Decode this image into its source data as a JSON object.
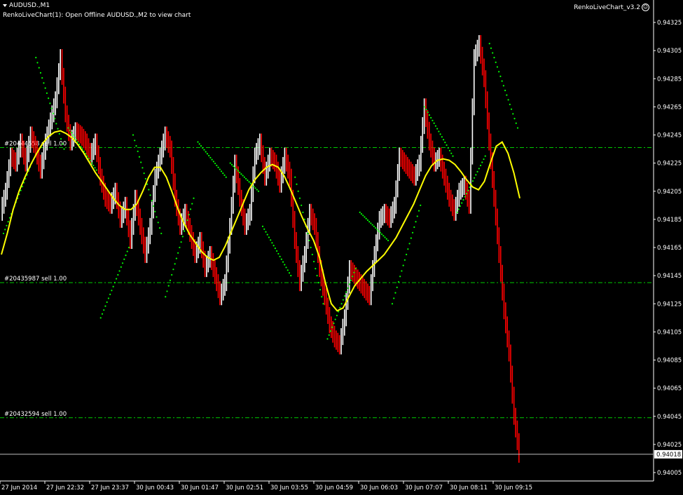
{
  "header": {
    "symbol_label": "AUDUSD.,M1",
    "status_text": "RenkoLiveChart(1): Open Offline AUDUSD.,M2 to view chart",
    "indicator_label": "RenkoLiveChart_v3.2"
  },
  "colors": {
    "background": "#000000",
    "bull_candle": "#ffffff",
    "bear_candle": "#ff0000",
    "moving_average": "#ffff00",
    "sar_dots": "#00ff00",
    "order_lines": "#00cc00",
    "axis_text": "#ffffff"
  },
  "chart_data": {
    "type": "line",
    "title": "",
    "xlabel": "",
    "ylabel": "",
    "ylim": [
      0.93995,
      0.94335
    ],
    "grid": false,
    "x_ticks": [
      "27 Jun 2014",
      "27 Jun 22:32",
      "27 Jun 23:37",
      "30 Jun 00:43",
      "30 Jun 01:47",
      "30 Jun 02:51",
      "30 Jun 03:55",
      "30 Jun 04:59",
      "30 Jun 06:03",
      "30 Jun 07:07",
      "30 Jun 08:11",
      "30 Jun 09:15"
    ],
    "y_ticks": [
      "0.94325",
      "0.94305",
      "0.94285",
      "0.94265",
      "0.94245",
      "0.94225",
      "0.94205",
      "0.94185",
      "0.94165",
      "0.94145",
      "0.94125",
      "0.94105",
      "0.94085",
      "0.94065",
      "0.94045",
      "0.94025",
      "0.94005"
    ],
    "current_price": "0.94018",
    "order_lines": [
      {
        "label": "#20444558 sell 1.00",
        "price": 0.94236
      },
      {
        "label": "#20435987 sell 1.00",
        "price": 0.9414
      },
      {
        "label": "#20432594 sell 1.00",
        "price": 0.94044
      }
    ],
    "close_series": [
      0.9419,
      0.94205,
      0.9423,
      0.94225,
      0.9424,
      0.94225,
      0.94245,
      0.94235,
      0.9422,
      0.9424,
      0.94255,
      0.9427,
      0.943,
      0.9426,
      0.9424,
      0.94248,
      0.94245,
      0.9424,
      0.9423,
      0.9424,
      0.94215,
      0.942,
      0.94195,
      0.94205,
      0.94185,
      0.94195,
      0.9417,
      0.942,
      0.9418,
      0.9416,
      0.9418,
      0.94215,
      0.9423,
      0.94245,
      0.94235,
      0.942,
      0.9418,
      0.9419,
      0.94175,
      0.9416,
      0.9417,
      0.9415,
      0.9416,
      0.94145,
      0.9413,
      0.9414,
      0.9418,
      0.94225,
      0.942,
      0.9418,
      0.9419,
      0.9423,
      0.9424,
      0.94215,
      0.9423,
      0.94225,
      0.9421,
      0.9423,
      0.94215,
      0.9417,
      0.9414,
      0.9416,
      0.9419,
      0.9418,
      0.9415,
      0.9413,
      0.9411,
      0.941,
      0.94095,
      0.94115,
      0.9415,
      0.94145,
      0.9414,
      0.94135,
      0.9413,
      0.9416,
      0.94185,
      0.9419,
      0.94185,
      0.94195,
      0.9423,
      0.94225,
      0.9422,
      0.94215,
      0.94225,
      0.94265,
      0.9424,
      0.94225,
      0.9423,
      0.94215,
      0.942,
      0.9419,
      0.94205,
      0.9421,
      0.94195,
      0.943,
      0.9431,
      0.94285,
      0.9424,
      0.942,
      0.9416,
      0.9412,
      0.9409,
      0.94045,
      0.94018
    ],
    "moving_average": [
      0.9416,
      0.94175,
      0.94192,
      0.94205,
      0.94215,
      0.94224,
      0.94232,
      0.94239,
      0.94244,
      0.94247,
      0.94248,
      0.94246,
      0.94243,
      0.94238,
      0.94232,
      0.94225,
      0.94218,
      0.94212,
      0.94206,
      0.942,
      0.94195,
      0.94192,
      0.94192,
      0.94196,
      0.94205,
      0.94215,
      0.94222,
      0.94222,
      0.94215,
      0.94204,
      0.94192,
      0.94182,
      0.94174,
      0.94168,
      0.94162,
      0.94158,
      0.94156,
      0.94158,
      0.94166,
      0.94176,
      0.94186,
      0.94196,
      0.94206,
      0.94213,
      0.94218,
      0.94222,
      0.94224,
      0.94222,
      0.94216,
      0.94207,
      0.94197,
      0.94187,
      0.94178,
      0.9417,
      0.94158,
      0.9414,
      0.94125,
      0.9412,
      0.94122,
      0.9413,
      0.94138,
      0.94143,
      0.94148,
      0.94152,
      0.94156,
      0.9416,
      0.94166,
      0.94172,
      0.9418,
      0.94188,
      0.94196,
      0.94206,
      0.94216,
      0.94223,
      0.94227,
      0.94228,
      0.94227,
      0.94224,
      0.94219,
      0.94213,
      0.94208,
      0.94206,
      0.94212,
      0.94225,
      0.94237,
      0.9424,
      0.94232,
      0.94218,
      0.942
    ],
    "sar_segments": [
      {
        "start": 0.94175,
        "end": 0.94225
      },
      {
        "start": 0.943,
        "end": 0.94235
      },
      {
        "start": 0.9425,
        "end": 0.9422
      },
      {
        "start": 0.94115,
        "end": 0.94165
      },
      {
        "start": 0.94245,
        "end": 0.94175
      },
      {
        "start": 0.9413,
        "end": 0.942
      },
      {
        "start": 0.9424,
        "end": 0.94215
      },
      {
        "start": 0.94225,
        "end": 0.94205
      },
      {
        "start": 0.9418,
        "end": 0.94145
      },
      {
        "start": 0.94215,
        "end": 0.94125
      },
      {
        "start": 0.941,
        "end": 0.9415
      },
      {
        "start": 0.9419,
        "end": 0.9417
      },
      {
        "start": 0.94125,
        "end": 0.94195
      },
      {
        "start": 0.94265,
        "end": 0.9423
      },
      {
        "start": 0.9419,
        "end": 0.9423
      },
      {
        "start": 0.9431,
        "end": 0.9425
      }
    ]
  }
}
